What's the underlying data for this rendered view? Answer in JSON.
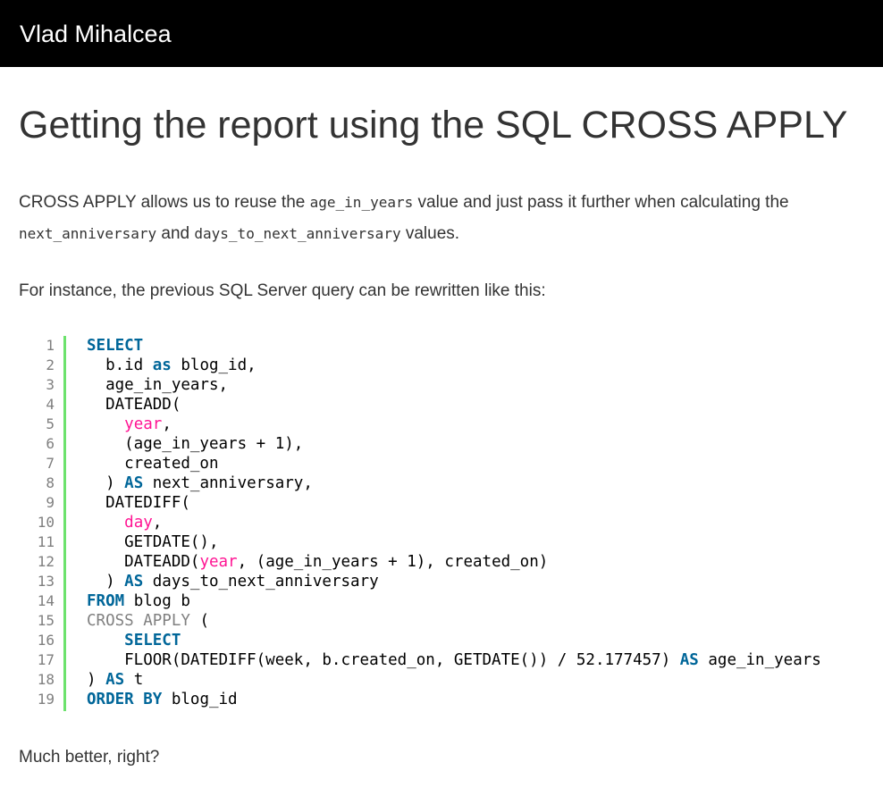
{
  "header": {
    "site_title": "Vlad Mihalcea"
  },
  "article": {
    "title": "Getting the report using the SQL CROSS APPLY",
    "p1": {
      "t1": "CROSS APPLY allows us to reuse the ",
      "c1": "age_in_years",
      "t2": " value and just pass it further when calculating the ",
      "c2": "next_anniversary",
      "t3": " and ",
      "c3": "days_to_next_anniversary",
      "t4": " values."
    },
    "p2": "For instance, the previous SQL Server query can be rewritten like this:",
    "p3": "Much better, right?"
  },
  "code": {
    "line_numbers": [
      "1",
      "2",
      "3",
      "4",
      "5",
      "6",
      "7",
      "8",
      "9",
      "10",
      "11",
      "12",
      "13",
      "14",
      "15",
      "16",
      "17",
      "18",
      "19"
    ],
    "lines": [
      [
        {
          "t": "SELECT",
          "c": "kw"
        }
      ],
      [
        {
          "t": "  b.id ",
          "c": ""
        },
        {
          "t": "as",
          "c": "kw"
        },
        {
          "t": " blog_id,",
          "c": ""
        }
      ],
      [
        {
          "t": "  age_in_years,",
          "c": ""
        }
      ],
      [
        {
          "t": "  DATEADD(",
          "c": "fn"
        }
      ],
      [
        {
          "t": "    ",
          "c": ""
        },
        {
          "t": "year",
          "c": "lit"
        },
        {
          "t": ",",
          "c": ""
        }
      ],
      [
        {
          "t": "    (age_in_years + 1),",
          "c": ""
        }
      ],
      [
        {
          "t": "    created_on",
          "c": ""
        }
      ],
      [
        {
          "t": "  ) ",
          "c": ""
        },
        {
          "t": "AS",
          "c": "kw"
        },
        {
          "t": " next_anniversary,",
          "c": ""
        }
      ],
      [
        {
          "t": "  DATEDIFF(",
          "c": "fn"
        }
      ],
      [
        {
          "t": "    ",
          "c": ""
        },
        {
          "t": "day",
          "c": "lit"
        },
        {
          "t": ",",
          "c": ""
        }
      ],
      [
        {
          "t": "    GETDATE(),",
          "c": ""
        }
      ],
      [
        {
          "t": "    DATEADD(",
          "c": ""
        },
        {
          "t": "year",
          "c": "lit"
        },
        {
          "t": ", (age_in_years + 1), created_on)",
          "c": ""
        }
      ],
      [
        {
          "t": "  ) ",
          "c": ""
        },
        {
          "t": "AS",
          "c": "kw"
        },
        {
          "t": " days_to_next_anniversary",
          "c": ""
        }
      ],
      [
        {
          "t": "FROM",
          "c": "kw"
        },
        {
          "t": " blog b",
          "c": ""
        }
      ],
      [
        {
          "t": "CROSS APPLY",
          "c": "gr"
        },
        {
          "t": " (",
          "c": ""
        }
      ],
      [
        {
          "t": "    ",
          "c": ""
        },
        {
          "t": "SELECT",
          "c": "kw"
        }
      ],
      [
        {
          "t": "    FLOOR(DATEDIFF(week, b.created_on, GETDATE()) / 52.177457) ",
          "c": ""
        },
        {
          "t": "AS",
          "c": "kw"
        },
        {
          "t": " age_in_years",
          "c": ""
        }
      ],
      [
        {
          "t": ") ",
          "c": ""
        },
        {
          "t": "AS",
          "c": "kw"
        },
        {
          "t": " t",
          "c": ""
        }
      ],
      [
        {
          "t": "ORDER BY",
          "c": "kw"
        },
        {
          "t": " blog_id",
          "c": ""
        }
      ]
    ]
  },
  "colors": {
    "header_bg": "#000000",
    "gutter_border": "#6ce26c",
    "keyword": "#006699",
    "literal": "#ff1493"
  }
}
